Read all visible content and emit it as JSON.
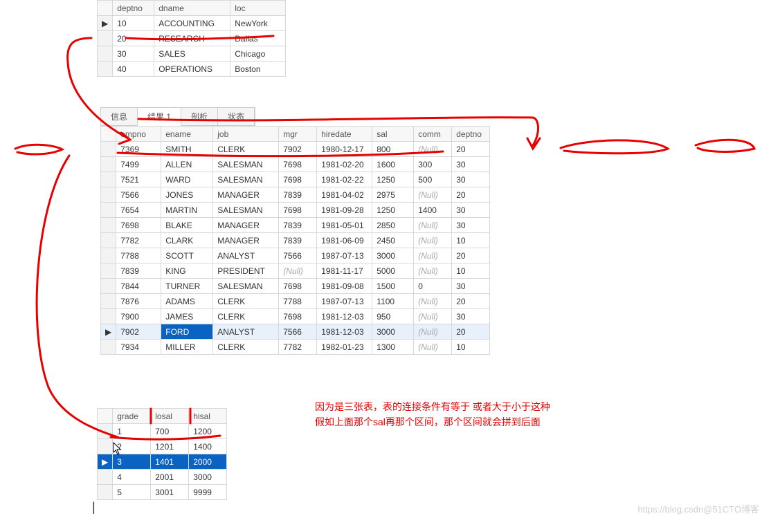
{
  "dept": {
    "headers": [
      "deptno",
      "dname",
      "loc"
    ],
    "rows": [
      {
        "deptno": "10",
        "dname": "ACCOUNTING",
        "loc": "NewYork",
        "marker": "▶"
      },
      {
        "deptno": "20",
        "dname": "RESEARCH",
        "loc": "Dallas",
        "marker": ""
      },
      {
        "deptno": "30",
        "dname": "SALES",
        "loc": "Chicago",
        "marker": ""
      },
      {
        "deptno": "40",
        "dname": "OPERATIONS",
        "loc": "Boston",
        "marker": ""
      }
    ]
  },
  "tabs": {
    "info": "信息",
    "result": "结果 1",
    "analyze": "剖析",
    "status": "状态"
  },
  "emp": {
    "headers": [
      "empno",
      "ename",
      "job",
      "mgr",
      "hiredate",
      "sal",
      "comm",
      "deptno"
    ],
    "rows": [
      {
        "empno": "7369",
        "ename": "SMITH",
        "job": "CLERK",
        "mgr": "7902",
        "hiredate": "1980-12-17",
        "sal": "800",
        "comm": "(Null)",
        "deptno": "20",
        "marker": ""
      },
      {
        "empno": "7499",
        "ename": "ALLEN",
        "job": "SALESMAN",
        "mgr": "7698",
        "hiredate": "1981-02-20",
        "sal": "1600",
        "comm": "300",
        "deptno": "30",
        "marker": ""
      },
      {
        "empno": "7521",
        "ename": "WARD",
        "job": "SALESMAN",
        "mgr": "7698",
        "hiredate": "1981-02-22",
        "sal": "1250",
        "comm": "500",
        "deptno": "30",
        "marker": ""
      },
      {
        "empno": "7566",
        "ename": "JONES",
        "job": "MANAGER",
        "mgr": "7839",
        "hiredate": "1981-04-02",
        "sal": "2975",
        "comm": "(Null)",
        "deptno": "20",
        "marker": ""
      },
      {
        "empno": "7654",
        "ename": "MARTIN",
        "job": "SALESMAN",
        "mgr": "7698",
        "hiredate": "1981-09-28",
        "sal": "1250",
        "comm": "1400",
        "deptno": "30",
        "marker": ""
      },
      {
        "empno": "7698",
        "ename": "BLAKE",
        "job": "MANAGER",
        "mgr": "7839",
        "hiredate": "1981-05-01",
        "sal": "2850",
        "comm": "(Null)",
        "deptno": "30",
        "marker": ""
      },
      {
        "empno": "7782",
        "ename": "CLARK",
        "job": "MANAGER",
        "mgr": "7839",
        "hiredate": "1981-06-09",
        "sal": "2450",
        "comm": "(Null)",
        "deptno": "10",
        "marker": ""
      },
      {
        "empno": "7788",
        "ename": "SCOTT",
        "job": "ANALYST",
        "mgr": "7566",
        "hiredate": "1987-07-13",
        "sal": "3000",
        "comm": "(Null)",
        "deptno": "20",
        "marker": ""
      },
      {
        "empno": "7839",
        "ename": "KING",
        "job": "PRESIDENT",
        "mgr": "(Null)",
        "hiredate": "1981-11-17",
        "sal": "5000",
        "comm": "(Null)",
        "deptno": "10",
        "marker": ""
      },
      {
        "empno": "7844",
        "ename": "TURNER",
        "job": "SALESMAN",
        "mgr": "7698",
        "hiredate": "1981-09-08",
        "sal": "1500",
        "comm": "0",
        "deptno": "30",
        "marker": ""
      },
      {
        "empno": "7876",
        "ename": "ADAMS",
        "job": "CLERK",
        "mgr": "7788",
        "hiredate": "1987-07-13",
        "sal": "1100",
        "comm": "(Null)",
        "deptno": "20",
        "marker": ""
      },
      {
        "empno": "7900",
        "ename": "JAMES",
        "job": "CLERK",
        "mgr": "7698",
        "hiredate": "1981-12-03",
        "sal": "950",
        "comm": "(Null)",
        "deptno": "30",
        "marker": ""
      },
      {
        "empno": "7902",
        "ename": "FORD",
        "job": "ANALYST",
        "mgr": "7566",
        "hiredate": "1981-12-03",
        "sal": "3000",
        "comm": "(Null)",
        "deptno": "20",
        "marker": "▶"
      },
      {
        "empno": "7934",
        "ename": "MILLER",
        "job": "CLERK",
        "mgr": "7782",
        "hiredate": "1982-01-23",
        "sal": "1300",
        "comm": "(Null)",
        "deptno": "10",
        "marker": ""
      }
    ]
  },
  "salgrade": {
    "headers": [
      "grade",
      "losal",
      "hisal"
    ],
    "rows": [
      {
        "grade": "1",
        "losal": "700",
        "hisal": "1200",
        "marker": ""
      },
      {
        "grade": "2",
        "losal": "1201",
        "hisal": "1400",
        "marker": ""
      },
      {
        "grade": "3",
        "losal": "1401",
        "hisal": "2000",
        "marker": "▶"
      },
      {
        "grade": "4",
        "losal": "2001",
        "hisal": "3000",
        "marker": ""
      },
      {
        "grade": "5",
        "losal": "3001",
        "hisal": "9999",
        "marker": ""
      }
    ]
  },
  "annotation": {
    "line1": "因为是三张表，表的连接条件有等于 或者大于小于这种",
    "line2": "假如上面那个sal再那个区间，那个区间就会拼到后面"
  },
  "watermark": "https://blog.csdn@51CTO博客"
}
